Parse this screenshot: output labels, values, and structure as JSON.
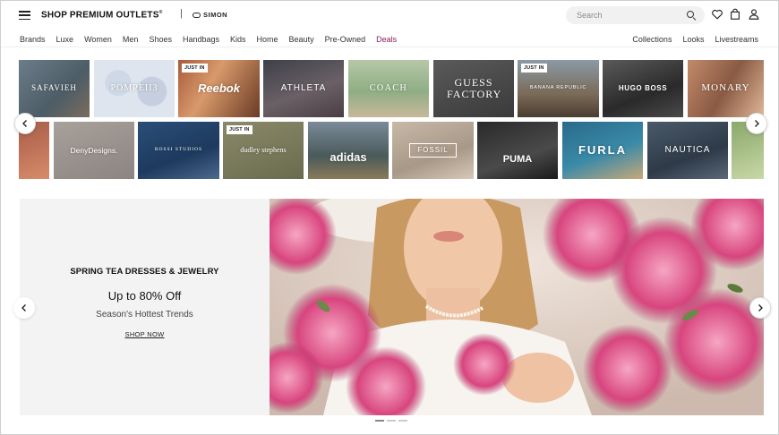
{
  "header": {
    "logo_text": "SHOP PREMIUM OUTLETS",
    "logo_trademark": "®",
    "separator": "|",
    "partner": "SIMON",
    "search_placeholder": "Search",
    "icons": [
      "menu-icon",
      "search-icon",
      "heart-icon",
      "bag-icon",
      "user-icon"
    ]
  },
  "nav": {
    "left": [
      "Brands",
      "Luxe",
      "Women",
      "Men",
      "Shoes",
      "Handbags",
      "Kids",
      "Home",
      "Beauty",
      "Pre-Owned",
      "Deals"
    ],
    "right": [
      "Collections",
      "Looks",
      "Livestreams"
    ],
    "deals_color": "#8a1f5c"
  },
  "brands_row1": [
    {
      "label": "SAFAVIEH",
      "badge": ""
    },
    {
      "label": "POMPEII3",
      "badge": ""
    },
    {
      "label": "Reebok",
      "badge": "JUST IN"
    },
    {
      "label": "ATHLETA",
      "badge": ""
    },
    {
      "label": "COACH",
      "badge": ""
    },
    {
      "label": "GUESS FACTORY",
      "badge": ""
    },
    {
      "label": "BANANA REPUBLIC",
      "badge": "JUST IN"
    },
    {
      "label": "HUGO BOSS",
      "badge": ""
    },
    {
      "label": "MONARY",
      "badge": ""
    }
  ],
  "brands_row2": [
    {
      "label": "",
      "badge": ""
    },
    {
      "label": "DenyDesigns.",
      "badge": ""
    },
    {
      "label": "ROSSI STUDIOS",
      "badge": ""
    },
    {
      "label": "dudley stephens",
      "badge": "JUST IN"
    },
    {
      "label": "adidas",
      "badge": ""
    },
    {
      "label": "FOSSIL",
      "badge": ""
    },
    {
      "label": "PUMA",
      "badge": ""
    },
    {
      "label": "FURLA",
      "badge": ""
    },
    {
      "label": "NAUTICA",
      "badge": ""
    },
    {
      "label": "",
      "badge": ""
    }
  ],
  "hero": {
    "title": "SPRING TEA DRESSES & JEWELRY",
    "offer": "Up to 80% Off",
    "subtitle": "Season's Hottest Trends",
    "cta": "SHOP NOW"
  },
  "carousel": {
    "slides": 3,
    "active": 0
  }
}
